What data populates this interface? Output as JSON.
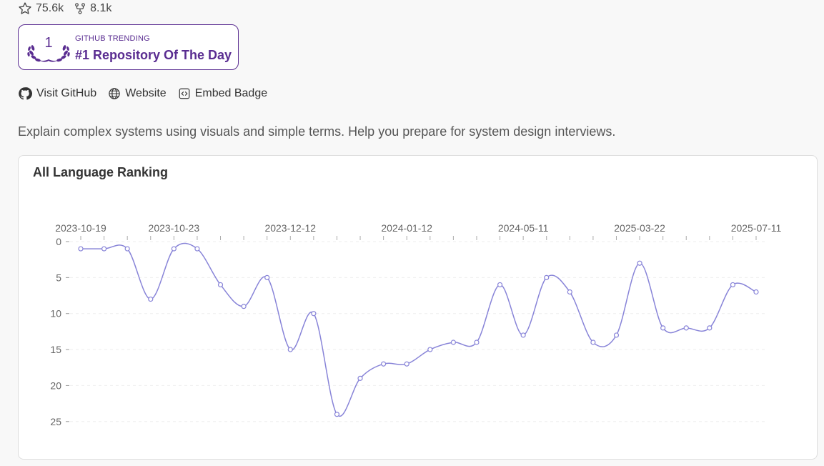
{
  "repo": {
    "stars": "75.6k",
    "forks": "8.1k",
    "description": "Explain complex systems using visuals and simple terms. Help you prepare for system design interviews."
  },
  "badge": {
    "rank": "1",
    "subtitle": "GITHUB TRENDING",
    "title": "#1 Repository Of The Day",
    "color": "#5a2d91"
  },
  "links": {
    "github": "Visit GitHub",
    "website": "Website",
    "embed": "Embed Badge"
  },
  "chart_card": {
    "title": "All Language Ranking"
  },
  "chart_data": {
    "type": "line",
    "title": "All Language Ranking",
    "x_tick_labels": [
      "2023-10-19",
      "2023-10-23",
      "2023-12-12",
      "2024-01-12",
      "2024-05-11",
      "2025-03-22",
      "2025-07-11"
    ],
    "x_tick_label_indices": [
      0,
      4,
      9,
      14,
      19,
      24,
      29
    ],
    "y_ticks": [
      0,
      5,
      10,
      15,
      20,
      25
    ],
    "y_inverted": true,
    "ylim": [
      0,
      25
    ],
    "line_color": "#8884d8",
    "grid": "horizontal dashed",
    "series": [
      {
        "values": [
          1,
          1,
          1,
          8,
          1,
          1,
          6,
          9,
          5,
          15,
          10,
          24,
          19,
          17,
          17,
          15,
          14,
          14,
          6,
          13,
          5,
          7,
          14,
          13,
          3,
          12,
          12,
          12,
          6,
          7
        ]
      }
    ]
  }
}
